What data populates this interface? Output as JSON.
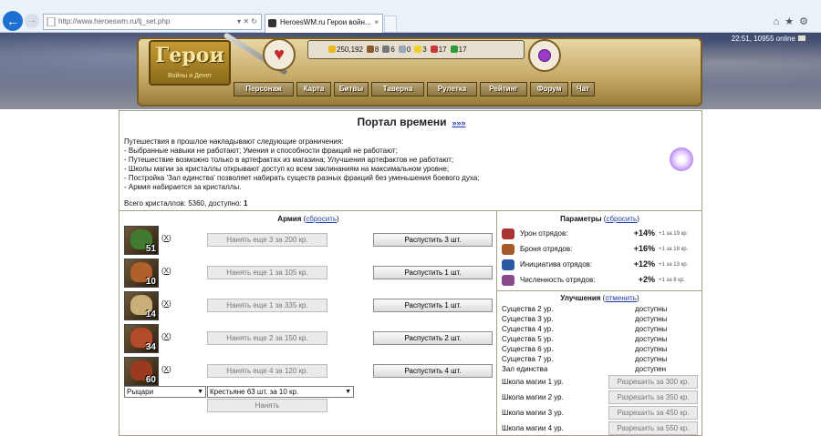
{
  "browser": {
    "url": "http://www.heroeswm.ru/tj_set.php",
    "tab_title": "HeroesWM.ru Герои войн...",
    "tab_close": "×",
    "url_controls": "▾ ✕ ↻"
  },
  "game": {
    "logo_title": "Герои",
    "logo_subtitle": "Войны и Денег",
    "resources": [
      {
        "icon": "gold-icon",
        "value": "250,192",
        "color": "#e8b923"
      },
      {
        "icon": "wood-icon",
        "value": "8",
        "color": "#8a5a2b"
      },
      {
        "icon": "ore-icon",
        "value": "6",
        "color": "#777777"
      },
      {
        "icon": "mercury-icon",
        "value": "0",
        "color": "#9aa6b5"
      },
      {
        "icon": "sulfur-icon",
        "value": "3",
        "color": "#f0d028"
      },
      {
        "icon": "crystal-icon",
        "value": "17",
        "color": "#c83a3a"
      },
      {
        "icon": "gem-icon",
        "value": "17",
        "color": "#2f9a3a"
      }
    ],
    "online_status": "22:51, 10955 online",
    "menu": [
      "Персонаж",
      "Карта",
      "Битвы",
      "Таверна",
      "Рулетка",
      "Рейтинг",
      "Форум",
      "Чат"
    ]
  },
  "portal": {
    "title": "Портал времени",
    "more_link": "»»»",
    "description": [
      "Путешествия в прошлое накладывают следующие ограничения:",
      "- Выбранные навыки не работают; Умения и способности фракций не работают;",
      "- Путешествие возможно только в артефактах из магазина; Улучшения артефактов не работают;",
      "- Школы магии за кристаллы открывают доступ ко всем заклинаниям на максимальном уровне;",
      "- Постройка 'Зал единства' позволяет набирать существ разных фракций без уменьшения боевого духа;",
      "- Армия набирается за кристаллы."
    ],
    "crystals_label": "Всего кристаллов: 5360, доступно:",
    "crystals_available": "1"
  },
  "army": {
    "title": "Армия",
    "reset_link": "сбросить",
    "remove_label": "X",
    "units": [
      {
        "count": "51",
        "hire": "Нанять еще 3 за 200 кр.",
        "dismiss": "Распустить 3 шт.",
        "color": "#3f7a2e"
      },
      {
        "count": "10",
        "hire": "Нанять еще 1 за 105 кр.",
        "dismiss": "Распустить 1 шт.",
        "color": "#b0602a"
      },
      {
        "count": "14",
        "hire": "Нанять еще 1 за 335 кр.",
        "dismiss": "Распустить 1 шт.",
        "color": "#c9b07a"
      },
      {
        "count": "34",
        "hire": "Нанять еще 2 за 150 кр.",
        "dismiss": "Распустить 2 шт.",
        "color": "#b34a2a"
      },
      {
        "count": "60",
        "hire": "Нанять еще 4 за 120 кр.",
        "dismiss": "Распустить 4 шт.",
        "color": "#9a3a1e"
      }
    ],
    "faction_select": "Рыцари",
    "unit_select": "Крестьяне 63 шт. за 10 кр.",
    "hire_button": "Нанять"
  },
  "params": {
    "title": "Параметры",
    "reset_link": "сбросить",
    "rows": [
      {
        "icon": "sword-icon",
        "label": "Урон отрядов:",
        "value": "+14%",
        "note": "+1 за 19 кр.",
        "color": "#a33"
      },
      {
        "icon": "shield-icon",
        "label": "Броня отрядов:",
        "value": "+16%",
        "note": "+1 за 18 кр.",
        "color": "#a65a2a"
      },
      {
        "icon": "initiative-icon",
        "label": "Инициатива отрядов:",
        "value": "+12%",
        "note": "+1 за 13 кр.",
        "color": "#2a5aa6"
      },
      {
        "icon": "troops-icon",
        "label": "Численность отрядов:",
        "value": "+2%",
        "note": "+1 за 8 кр.",
        "color": "#8a4a8a"
      }
    ]
  },
  "upgrades": {
    "title": "Улучшения",
    "cancel_link": "отменить",
    "rows": [
      {
        "label": "Существа 2 ур.",
        "status": "доступны"
      },
      {
        "label": "Существа 3 ур.",
        "status": "доступны"
      },
      {
        "label": "Существа 4 ур.",
        "status": "доступны"
      },
      {
        "label": "Существа 5 ур.",
        "status": "доступны"
      },
      {
        "label": "Существа 6 ур.",
        "status": "доступны"
      },
      {
        "label": "Существа 7 ур.",
        "status": "доступны"
      },
      {
        "label": "Зал единства",
        "status": "доступен"
      }
    ],
    "magic": [
      {
        "label": "Школа магии 1 ур.",
        "button": "Разрешить за 300 кр."
      },
      {
        "label": "Школа магии 2 ур.",
        "button": "Разрешить за 350 кр."
      },
      {
        "label": "Школа магии 3 ур.",
        "button": "Разрешить за 450 кр."
      },
      {
        "label": "Школа магии 4 ур.",
        "button": "Разрешить за 550 кр."
      }
    ]
  }
}
